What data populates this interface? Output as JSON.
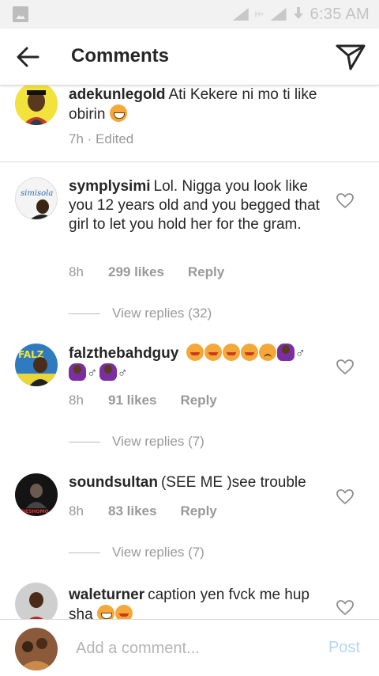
{
  "status_bar": {
    "time": "6:35 AM",
    "network": "H+"
  },
  "header": {
    "title": "Comments"
  },
  "comments": [
    {
      "user": "adekunlegold",
      "text": "Ati Kekere ni mo ti like obirin",
      "time": "7h",
      "edited": "· Edited"
    },
    {
      "user": "symplysimi",
      "text": "Lol. Nigga you look like you 12 years old and you begged that girl to let you hold her for the gram.",
      "time": "8h",
      "likes": "299 likes",
      "reply": "Reply",
      "view_replies": "View replies (32)",
      "avatar_text": "simisola"
    },
    {
      "user": "falzthebahdguy",
      "text": "",
      "time": "8h",
      "likes": "91 likes",
      "reply": "Reply",
      "view_replies": "View replies (7)",
      "avatar_text": "FALZ"
    },
    {
      "user": "soundsultan",
      "text": "(SEE ME )see trouble",
      "time": "8h",
      "likes": "83 likes",
      "reply": "Reply",
      "view_replies": "View replies (7)",
      "avatar_text": "DESHOMO"
    },
    {
      "user": "waleturner",
      "text": "caption yen fvck me hup sha"
    }
  ],
  "composer": {
    "placeholder": "Add a comment...",
    "post_label": "Post"
  },
  "colors": {
    "text": "#262626",
    "muted": "#999999",
    "post": "#b3d6f5",
    "divider": "#dbdbdb"
  }
}
